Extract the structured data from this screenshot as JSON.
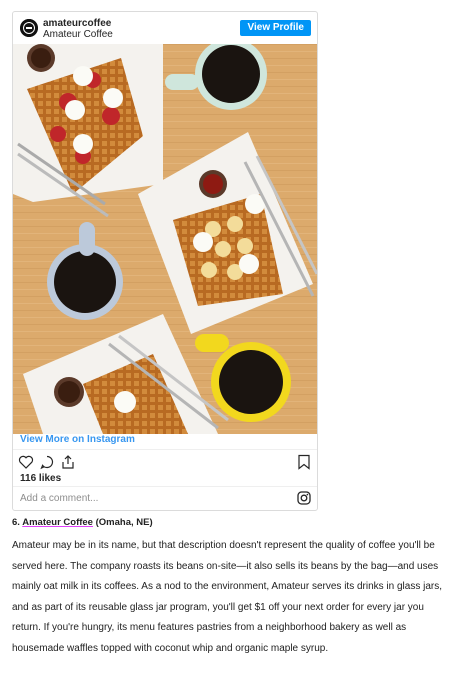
{
  "instagram": {
    "username": "amateurcoffee",
    "full_name": "Amateur Coffee",
    "view_profile_label": "View Profile",
    "view_more_label": "View More on Instagram",
    "likes": "116 likes",
    "comment_placeholder": "Add a comment...",
    "icons": [
      "heart-icon",
      "comment-icon",
      "share-icon",
      "bookmark-icon",
      "instagram-icon"
    ]
  },
  "article": {
    "heading_prefix": "6.",
    "heading_link": "Amateur Coffee",
    "heading_suffix": "(Omaha, NE)",
    "body": "Amateur may be in its name, but that description doesn't represent the quality of coffee you'll be served here. The company roasts its beans on-site—it also sells its beans by the bag—and uses mainly oat milk in its coffees. As a nod to the environment, Amateur serves its drinks in glass jars, and as part of its reusable glass jar program, you'll get $1 off your next order for every jar you return. If you're hungry, its menu features pastries from a neighborhood bakery as well as housemade waffles topped with coconut whip and organic maple syrup."
  },
  "colors": {
    "button_blue": "#0095f6",
    "link_blue": "#3897f0",
    "link_underline": "#e040fb",
    "table_wood": "#d9a86a"
  }
}
